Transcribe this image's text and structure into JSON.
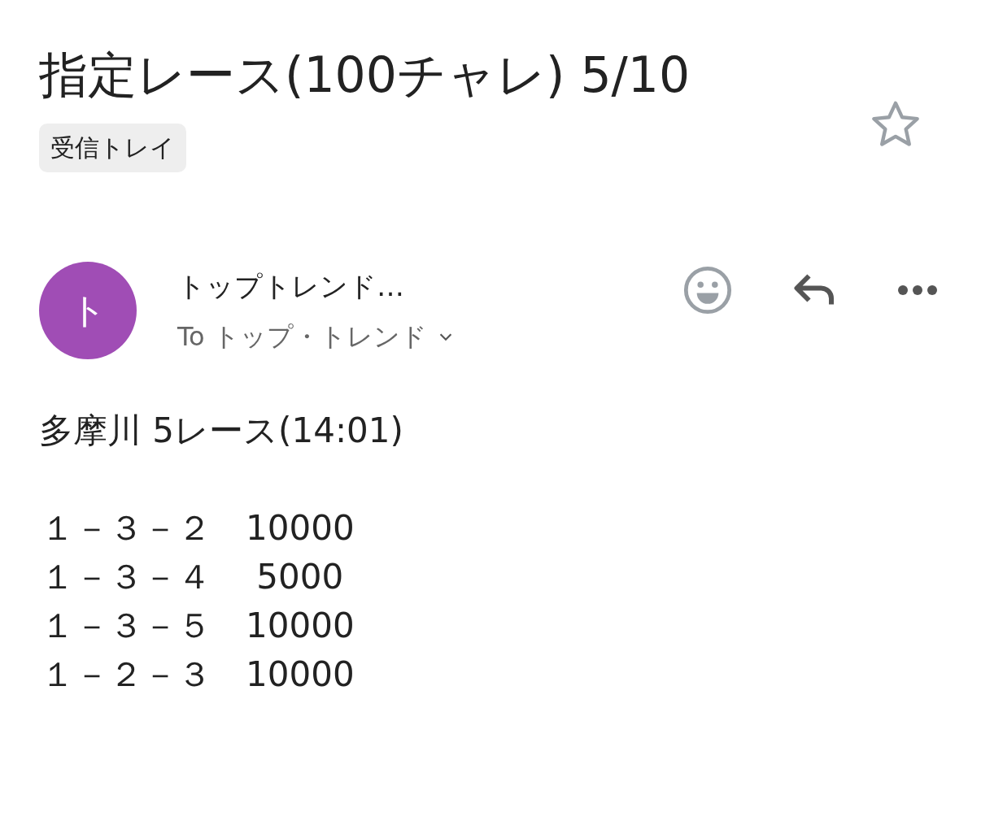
{
  "subject": "指定レース(100チャレ) 5/10",
  "starred": false,
  "labels": [
    "受信トレイ"
  ],
  "sender": {
    "initial": "ト",
    "color": "#a04db5",
    "name": "トップトレンド…",
    "to_prefix": "To",
    "to": "トップ・トレンド",
    "details_expanded": false
  },
  "body_heading": "多摩川 5レース(14:01)",
  "body_lines": [
    "１－３－２　10000",
    "１－３－４　 5000",
    "１－３－５　10000",
    "１－２－３　10000"
  ]
}
